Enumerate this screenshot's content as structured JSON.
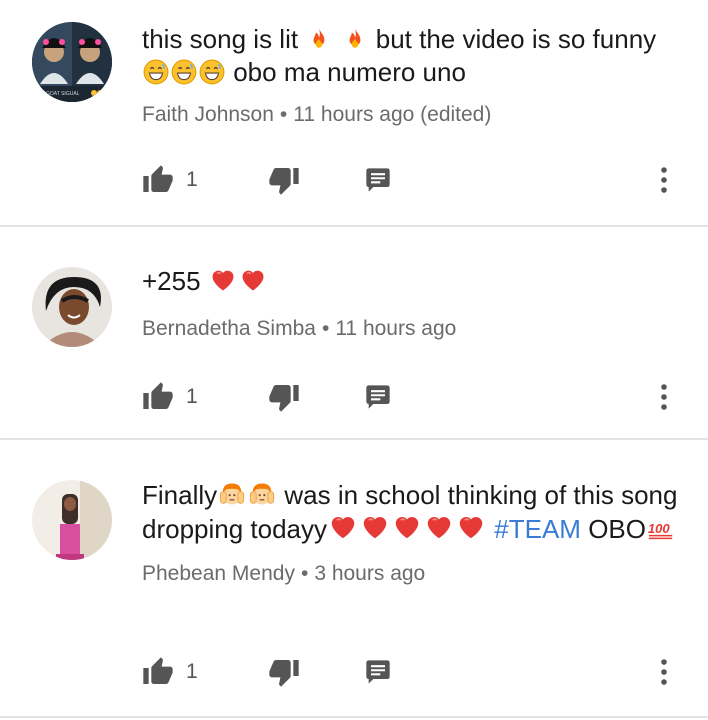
{
  "comments": [
    {
      "text_a": "this song is lit ",
      "text_b": " but the video is so funny",
      "text_c": " obo ma numero uno",
      "author": "Faith Johnson",
      "separator": "•",
      "time": "11 hours ago (edited)",
      "likes": "1",
      "avatar_caption": "GOAT SIGUAL"
    },
    {
      "text_a": "+255 ",
      "author": "Bernadetha Simba",
      "separator": "•",
      "time": "11 hours ago",
      "likes": "1"
    },
    {
      "text_a": "Finally",
      "text_b": " was in school thinking of this song dropping todayy",
      "hashtag": "#TEAM",
      "text_c": "OBO",
      "author": "Phebean Mendy",
      "separator": "•",
      "time": "3 hours ago",
      "likes": "1"
    }
  ],
  "icons": {
    "like": "thumb-up-icon",
    "dislike": "thumb-down-icon",
    "reply": "reply-comment-icon",
    "more": "more-vertical-icon",
    "fire": "fire-emoji",
    "grin": "grinning-sweat-emoji",
    "heart": "heart-emoji",
    "facepalm": "face-palm-emoji",
    "hundred": "hundred-points-emoji"
  },
  "colors": {
    "text": "#1a1a1a",
    "meta": "#6b6b6b",
    "icon": "#555555",
    "divider": "#e3e3e3",
    "hashtag": "#3a7bd5"
  }
}
